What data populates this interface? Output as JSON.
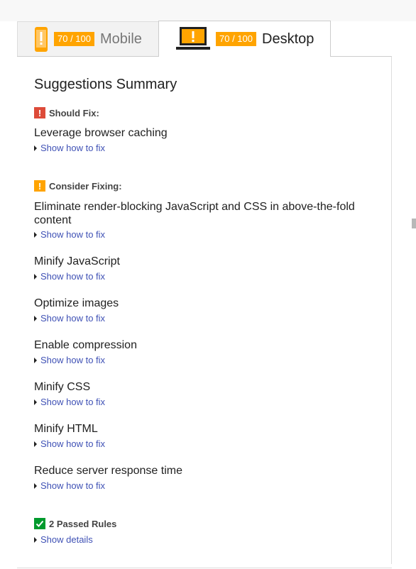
{
  "tabs": {
    "mobile": {
      "score": "70 / 100",
      "label": "Mobile",
      "icon": "phone-warning-icon"
    },
    "desktop": {
      "score": "70 / 100",
      "label": "Desktop",
      "icon": "laptop-warning-icon"
    }
  },
  "summary": {
    "title": "Suggestions Summary",
    "should_fix": {
      "label": "Should Fix:",
      "rules": [
        {
          "title": "Leverage browser caching",
          "link": "Show how to fix"
        }
      ]
    },
    "consider_fixing": {
      "label": "Consider Fixing:",
      "rules": [
        {
          "title": "Eliminate render-blocking JavaScript and CSS in above-the-fold content",
          "link": "Show how to fix"
        },
        {
          "title": "Minify JavaScript",
          "link": "Show how to fix"
        },
        {
          "title": "Optimize images",
          "link": "Show how to fix"
        },
        {
          "title": "Enable compression",
          "link": "Show how to fix"
        },
        {
          "title": "Minify CSS",
          "link": "Show how to fix"
        },
        {
          "title": "Minify HTML",
          "link": "Show how to fix"
        },
        {
          "title": "Reduce server response time",
          "link": "Show how to fix"
        }
      ]
    },
    "passed": {
      "label": "2 Passed Rules",
      "link": "Show details"
    }
  },
  "colors": {
    "badge": "#ffa400",
    "should_fix": "#dd4b39",
    "consider_fixing": "#ffa400",
    "passed": "#009a2d",
    "link": "#3f51b5"
  }
}
